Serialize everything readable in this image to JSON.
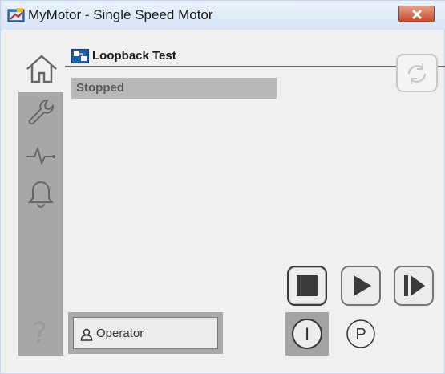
{
  "window": {
    "title": "MyMotor - Single Speed Motor"
  },
  "header": {
    "title": "Loopback Test"
  },
  "status": {
    "text": "Stopped"
  },
  "nav": {
    "items": [
      "home-icon",
      "wrench-icon",
      "trend-icon",
      "bell-icon"
    ],
    "help_label": "?"
  },
  "commands": [
    "stop-icon",
    "start-icon",
    "jog-icon"
  ],
  "operator": {
    "label": "Operator"
  },
  "modes": {
    "internal_label": "I",
    "program_label": "P"
  },
  "colors": {
    "close_button": "#c5472a",
    "nav_background": "#a7a7a7",
    "status_background": "#b8b8b8"
  }
}
